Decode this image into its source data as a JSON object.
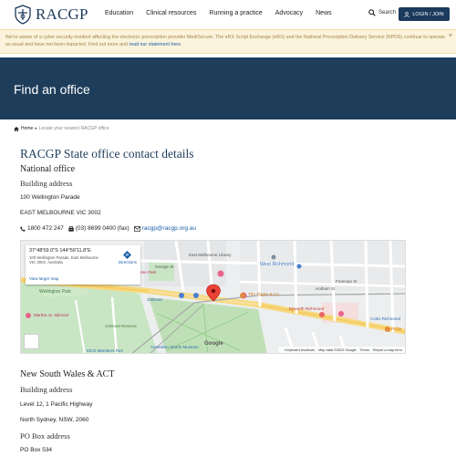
{
  "header": {
    "logo_text": "RACGP",
    "nav": [
      "Education",
      "Clinical resources",
      "Running a practice",
      "Advocacy",
      "News"
    ],
    "search_label": "Search",
    "login_label": "LOGIN / JOIN"
  },
  "alert": {
    "text": "We're aware of a cyber security incident affecting the electronic prescription provider MediSecure. The eRX Script Exchange (eRX) and the National Prescription Delivery Service (NPDS) continue to operate as usual and have not been impacted. Find out more and ",
    "link": "read our statement here",
    "after": ".",
    "close": "×"
  },
  "hero": {
    "title": "Find an office"
  },
  "breadcrumb": {
    "home": "Home",
    "separator": "▸",
    "current": "Locate your nearest RACGP office"
  },
  "main": {
    "title": "RACGP State office contact details",
    "national": {
      "heading": "National office",
      "building_heading": "Building address",
      "street": "100 Wellington Parade",
      "city": "EAST MELBOURNE VIC 3002",
      "phone": "1800 472 247",
      "fax": "(03) 8699 0400 (fax)",
      "email": "racgp@racgp.org.au"
    },
    "map": {
      "coords": "37°48'59.0\"S 144°59'11.8\"E",
      "address": "100 Wellington Parade, East Melbourne VIC 3002, Australia",
      "directions": "Directions",
      "larger_map": "View larger map",
      "labels": {
        "east_melbourne_library": "East Melbourne Library",
        "west_richmond": "West Richmond",
        "wellington_park": "Wellington Park",
        "jolimont_reserve": "Jolimont Reserve",
        "jolimont": "Jolimont",
        "tippler": "The Tippler & Co.",
        "epworth": "Epworth Richmond",
        "coles": "Coles Richmond",
        "martha": "Martha on Jolimont",
        "mcg": "MCG Members Res",
        "national_sports": "Australian Sports Museum",
        "george_st": "George St",
        "hotham_st": "Hotham St",
        "freeman_st": "Freeman St",
        "lume": "lume Park",
        "rich": "Riche"
      },
      "footer": [
        "Keyboard shortcuts",
        "Map data ©2024 Google",
        "Terms",
        "Report a map error"
      ],
      "google": "Google"
    },
    "nsw": {
      "heading": "New South Wales & ACT",
      "building_heading": "Building address",
      "street": "Level 12, 1 Pacific Highway",
      "city": "North Sydney, NSW, 2060",
      "po_heading": "PO Box address",
      "po_value": "PO Box 534"
    }
  },
  "colors": {
    "navy": "#1e3d5b",
    "link": "#1b5fa8",
    "alert_bg": "#fbf3dc",
    "alert_text": "#a5864a"
  }
}
